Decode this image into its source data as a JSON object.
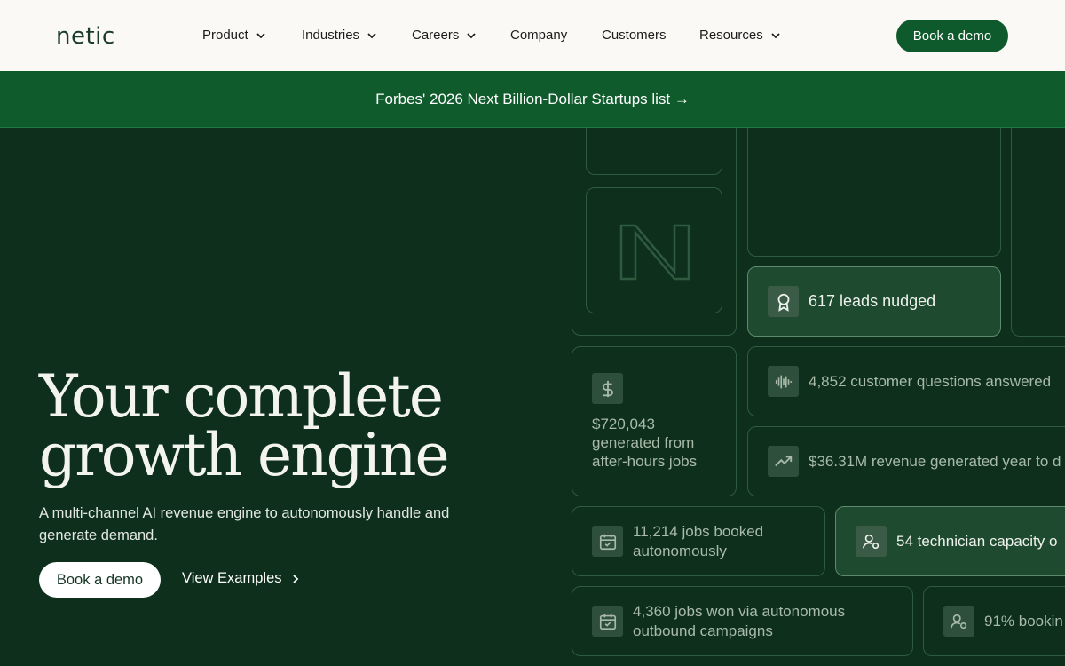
{
  "nav": {
    "logo": "netic",
    "items": [
      {
        "label": "Product"
      },
      {
        "label": "Industries"
      },
      {
        "label": "Careers"
      },
      {
        "label": "Company"
      },
      {
        "label": "Customers"
      },
      {
        "label": "Resources"
      }
    ],
    "cta": "Book a demo"
  },
  "banner": {
    "text": "Forbes' 2026 Next Billion-Dollar Startups list →"
  },
  "hero": {
    "headline_line1": "Your complete",
    "headline_line2": "growth engine",
    "subtitle": "A multi-channel AI revenue engine to autonomously handle and generate demand.",
    "primary_cta": "Book a demo",
    "secondary_cta": "View Examples"
  },
  "stats": {
    "leads_nudged": "617 leads nudged",
    "questions_answered": "4,852 customer questions answered",
    "after_hours_line1": "$720,043",
    "after_hours_line2": "generated from",
    "after_hours_line3": "after-hours jobs",
    "revenue_ytd": "$36.31M revenue generated year to d",
    "jobs_booked_line1": "11,214 jobs booked",
    "jobs_booked_line2": "autonomously",
    "technician_capacity": "54 technician capacity o",
    "outbound_line1": "4,360 jobs won via autonomous",
    "outbound_line2": "outbound campaigns",
    "booking_rate": "91% bookin"
  },
  "icons": {
    "leads": "award-icon",
    "questions": "audio-wave-icon",
    "dollar": "dollar-icon",
    "revenue": "trending-up-icon",
    "calendar": "calendar-check-icon",
    "technician": "user-gear-icon"
  },
  "colors": {
    "hero_bg": "#0d2f1c",
    "banner_bg": "#0f5b2c",
    "cta_bg": "#0e5a2c",
    "nav_bg": "#faf9f6"
  }
}
